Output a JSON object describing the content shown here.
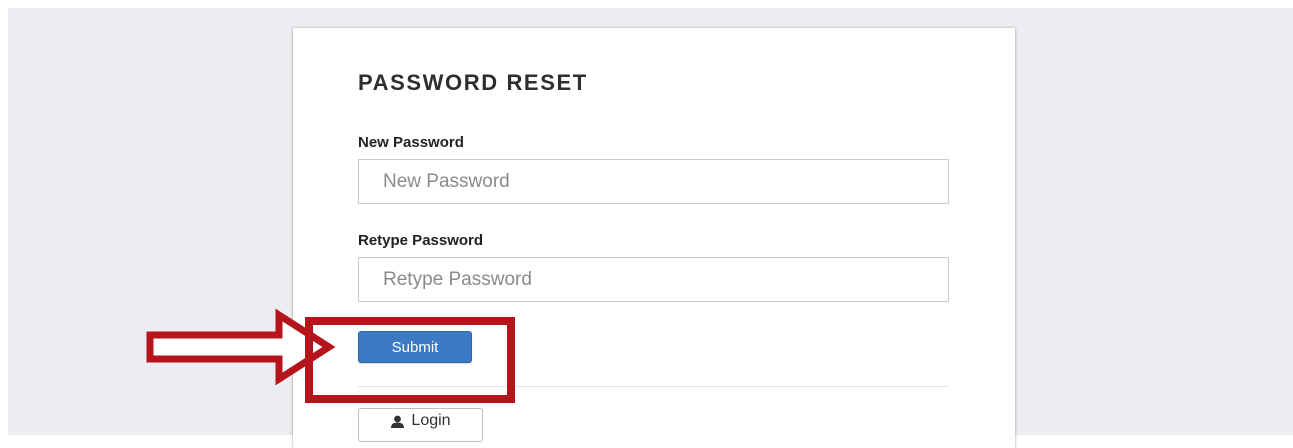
{
  "form": {
    "title": "PASSWORD RESET",
    "new_password": {
      "label": "New Password",
      "placeholder": "New Password"
    },
    "retype_password": {
      "label": "Retype Password",
      "placeholder": "Retype Password"
    },
    "submit_label": "Submit",
    "login_label": "Login",
    "login_icon": "user-icon"
  },
  "annotation": {
    "color": "#b5141a",
    "arrow_direction": "right",
    "highlight_target": "submit-button"
  },
  "colors": {
    "primary_button": "#3a7bc4",
    "background": "#ecedf0"
  }
}
